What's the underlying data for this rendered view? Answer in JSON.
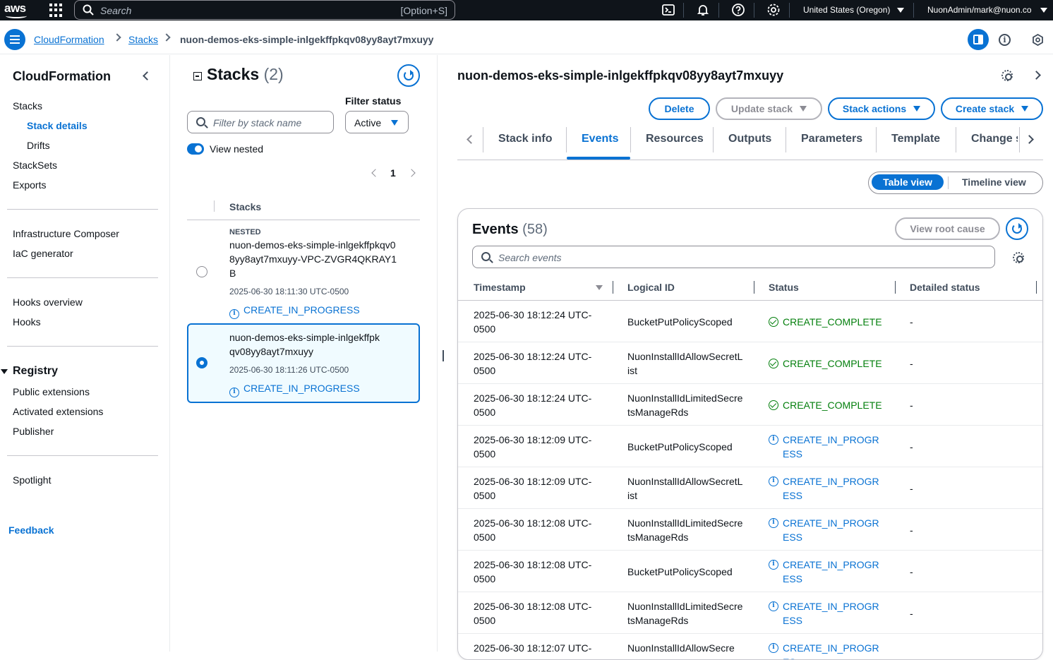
{
  "topbar": {
    "logo": "aws",
    "search_placeholder": "Search",
    "search_shortcut": "[Option+S]",
    "region": "United States (Oregon)",
    "account": "NuonAdmin/mark@nuon.co",
    "icons": [
      "cloudshell-icon",
      "bell-icon",
      "help-icon",
      "settings-icon"
    ]
  },
  "breadcrumb": {
    "items": [
      "CloudFormation",
      "Stacks"
    ],
    "current": "nuon-demos-eks-simple-inlgekffpkqv08yy8ayt7mxuyy"
  },
  "sidebar": {
    "title": "CloudFormation",
    "items": [
      "Stacks",
      "Stack details",
      "Drifts",
      "StackSets",
      "Exports"
    ],
    "group2": [
      "Infrastructure Composer",
      "IaC generator"
    ],
    "group3": [
      "Hooks overview",
      "Hooks"
    ],
    "registry_title": "Registry",
    "registry_items": [
      "Public extensions",
      "Activated extensions",
      "Publisher"
    ],
    "spotlight": "Spotlight",
    "feedback": "Feedback"
  },
  "stacks_panel": {
    "title": "Stacks",
    "count": "(2)",
    "filter_status_label": "Filter status",
    "filter_placeholder": "Filter by stack name",
    "filter_status_value": "Active",
    "view_nested_label": "View nested",
    "page": "1",
    "column_header": "Stacks",
    "rows": [
      {
        "badge": "NESTED",
        "name": "nuon-demos-eks-simple-inlgekffpkqv08yy8ayt7mxuyy-VPC-ZVGR4QKRAY1B",
        "time": "2025-06-30 18:11:30 UTC-0500",
        "status": "CREATE_IN_PROGRESS"
      },
      {
        "badge": "",
        "name": "nuon-demos-eks-simple-inlgekffpkqv08yy8ayt7mxuyy",
        "time": "2025-06-30 18:11:26 UTC-0500",
        "status": "CREATE_IN_PROGRESS"
      }
    ]
  },
  "detail": {
    "title": "nuon-demos-eks-simple-inlgekffpkqv08yy8ayt7mxuyy",
    "buttons": {
      "delete": "Delete",
      "update": "Update stack",
      "actions": "Stack actions",
      "create": "Create stack"
    },
    "tabs": [
      "Stack info",
      "Events",
      "Resources",
      "Outputs",
      "Parameters",
      "Template",
      "Change s"
    ],
    "view_toggle": {
      "table": "Table view",
      "timeline": "Timeline view"
    },
    "events": {
      "title": "Events",
      "count": "(58)",
      "root_cause_button": "View root cause",
      "search_placeholder": "Search events",
      "columns": [
        "Timestamp",
        "Logical ID",
        "Status",
        "Detailed status"
      ],
      "rows": [
        {
          "ts": "2025-06-30 18:12:24 UTC-0500",
          "lid": "BucketPutPolicyScoped",
          "status": "CREATE_COMPLETE",
          "detail": "-"
        },
        {
          "ts": "2025-06-30 18:12:24 UTC-0500",
          "lid": "NuonInstallIdAllowSecretList",
          "status": "CREATE_COMPLETE",
          "detail": "-"
        },
        {
          "ts": "2025-06-30 18:12:24 UTC-0500",
          "lid": "NuonInstallIdLimitedSecretsManageRds",
          "status": "CREATE_COMPLETE",
          "detail": "-"
        },
        {
          "ts": "2025-06-30 18:12:09 UTC-0500",
          "lid": "BucketPutPolicyScoped",
          "status": "CREATE_IN_PROGRESS",
          "detail": "-"
        },
        {
          "ts": "2025-06-30 18:12:09 UTC-0500",
          "lid": "NuonInstallIdAllowSecretList",
          "status": "CREATE_IN_PROGRESS",
          "detail": "-"
        },
        {
          "ts": "2025-06-30 18:12:08 UTC-0500",
          "lid": "NuonInstallIdLimitedSecretsManageRds",
          "status": "CREATE_IN_PROGRESS",
          "detail": "-"
        },
        {
          "ts": "2025-06-30 18:12:08 UTC-0500",
          "lid": "BucketPutPolicyScoped",
          "status": "CREATE_IN_PROGRESS",
          "detail": "-"
        },
        {
          "ts": "2025-06-30 18:12:08 UTC-0500",
          "lid": "NuonInstallIdLimitedSecretsManageRds",
          "status": "CREATE_IN_PROGRESS",
          "detail": "-"
        },
        {
          "ts": "2025-06-30 18:12:07 UTC-",
          "lid": "NuonInstallIdAllowSecre",
          "status": "CREATE_IN_PROGRES",
          "detail": ""
        }
      ]
    }
  },
  "colors": {
    "accent": "#0972d3",
    "success": "#037f0c",
    "topbar_bg": "#0f141a"
  }
}
